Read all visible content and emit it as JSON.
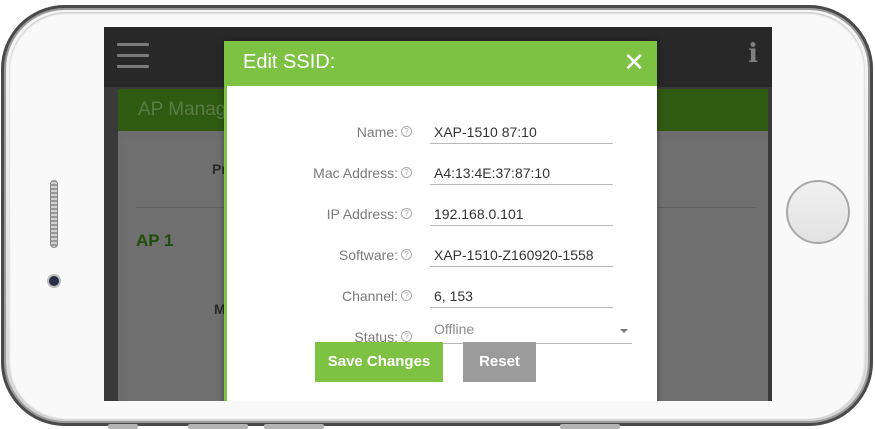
{
  "app": {
    "background_title": "AP Manag",
    "background_ap": "AP 1",
    "background_fragments": [
      "Pr",
      "M"
    ]
  },
  "modal": {
    "title": "Edit SSID:",
    "close_glyph": "✕",
    "fields": [
      {
        "label": "Name:",
        "value": "XAP-1510 87:10"
      },
      {
        "label": "Mac Address:",
        "value": "A4:13:4E:37:87:10"
      },
      {
        "label": "IP Address:",
        "value": "192.168.0.101"
      },
      {
        "label": "Software:",
        "value": "XAP-1510-Z160920-1558"
      },
      {
        "label": "Channel:",
        "value": "6, 153"
      }
    ],
    "status": {
      "label": "Status:",
      "value": "Offline"
    },
    "help_glyph": "?",
    "save_label": "Save Changes",
    "reset_label": "Reset"
  },
  "colors": {
    "accent": "#7dc242",
    "reset_button": "#9b9b9b",
    "topbar": "#282828"
  },
  "icons": {
    "menu": "hamburger-icon",
    "info": "info-icon",
    "close": "close-icon",
    "help": "help-icon",
    "dropdown": "chevron-down-icon"
  }
}
